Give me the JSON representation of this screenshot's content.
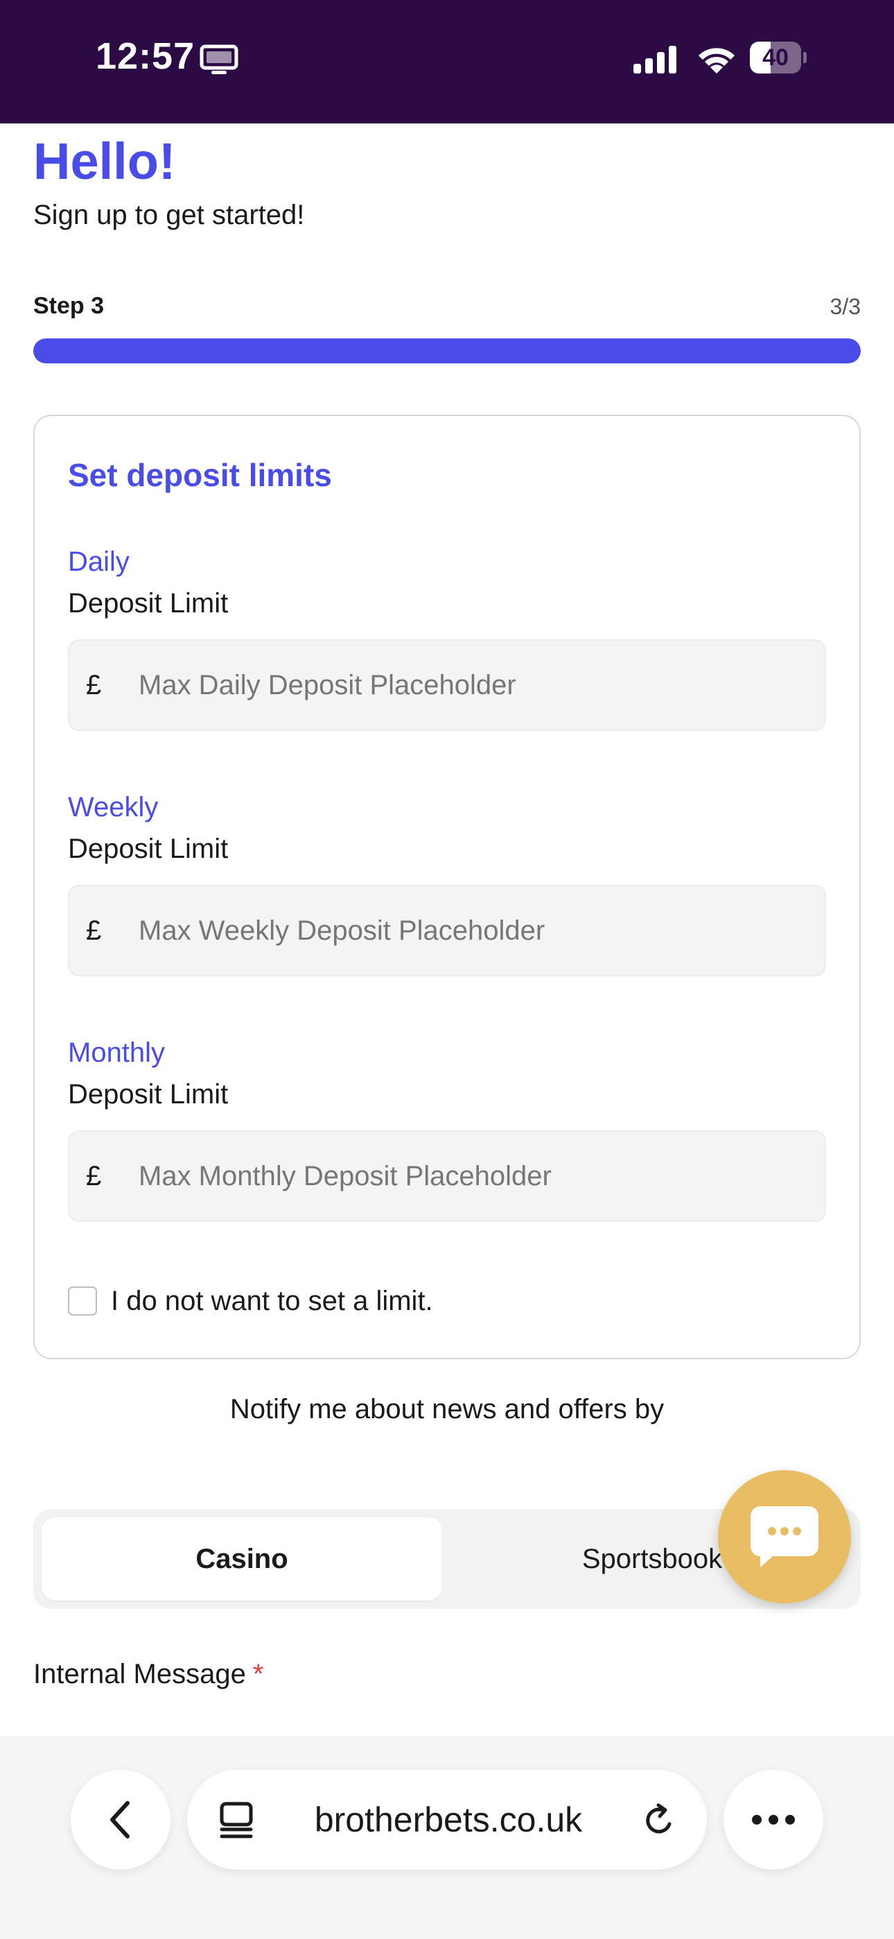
{
  "status_bar": {
    "time": "12:57",
    "battery_level": "40",
    "battery_fraction": 0.4,
    "icons": [
      "screen-mirroring-icon",
      "cellular-signal-icon",
      "wifi-icon",
      "battery-icon"
    ]
  },
  "header": {
    "title": "Hello!",
    "subtitle": "Sign up to get started!"
  },
  "progress": {
    "step_label": "Step 3",
    "step_count": "3/3",
    "fraction": 1.0
  },
  "deposit_card": {
    "title": "Set deposit limits",
    "currency_symbol": "£",
    "limits": [
      {
        "period": "Daily",
        "label": "Deposit Limit",
        "placeholder": "Max Daily Deposit Placeholder",
        "value": ""
      },
      {
        "period": "Weekly",
        "label": "Deposit Limit",
        "placeholder": "Max Weekly Deposit Placeholder",
        "value": ""
      },
      {
        "period": "Monthly",
        "label": "Deposit Limit",
        "placeholder": "Max Monthly Deposit Placeholder",
        "value": ""
      }
    ],
    "no_limit_label": "I do not want to set a limit.",
    "no_limit_checked": false
  },
  "notify_text": "Notify me about news and offers by",
  "segment": {
    "options": [
      "Casino",
      "Sportsbook"
    ],
    "selected": "Casino"
  },
  "internal_message": {
    "label": "Internal Message",
    "required_mark": "*"
  },
  "browser": {
    "url": "brotherbets.co.uk",
    "icons": [
      "back-arrow-icon",
      "page-tabs-icon",
      "reload-icon",
      "more-dots-icon"
    ]
  },
  "colors": {
    "accent": "#4a4ce8",
    "status_bar_bg": "#2c0b45",
    "chat_fab": "#e9bd63",
    "required": "#e03c3c"
  }
}
